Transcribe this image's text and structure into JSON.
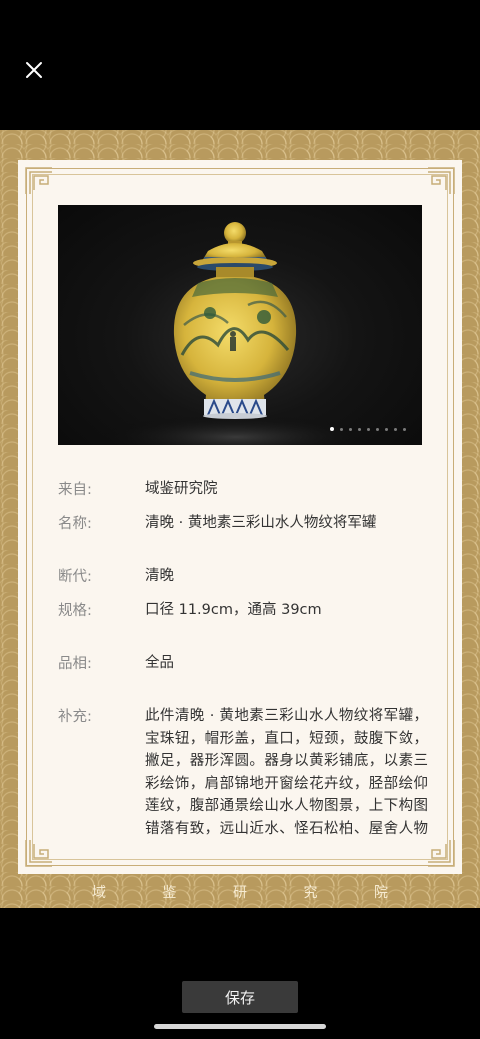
{
  "icons": {
    "close": "close-icon"
  },
  "carousel": {
    "total": 9,
    "active_index": 0
  },
  "info": {
    "from": {
      "label": "来自:",
      "value": "域鉴研究院"
    },
    "name": {
      "label": "名称:",
      "value": "清晚 · 黄地素三彩山水人物纹将军罐"
    },
    "dynasty": {
      "label": "断代:",
      "value": "清晚"
    },
    "spec": {
      "label": "规格:",
      "value": "口径 11.9cm，通高 39cm"
    },
    "condition": {
      "label": "品相:",
      "value": "全品"
    },
    "supplement": {
      "label": "补充:",
      "value": "此件清晚 · 黄地素三彩山水人物纹将军罐，宝珠钮，帽形盖，直口，短颈，鼓腹下敛，撇足，器形浑圆。器身以黄彩铺底，以素三彩绘饰，肩部锦地开窗绘花卉纹，胫部绘仰莲纹，腹部通景绘山水人物图景，上下构图错落有致，远山近水、怪石松柏、屋舍人物皆表现得十分生动，在黄彩的映衬下颇具视觉冲击感，为陈设著"
    }
  },
  "brand": [
    "域",
    "鉴",
    "研",
    "究",
    "院"
  ],
  "save_label": "保存",
  "colors": {
    "background": "#000000",
    "poster": "#b89a5e",
    "card": "#fbf6ef",
    "frame": "#c8ad78"
  }
}
